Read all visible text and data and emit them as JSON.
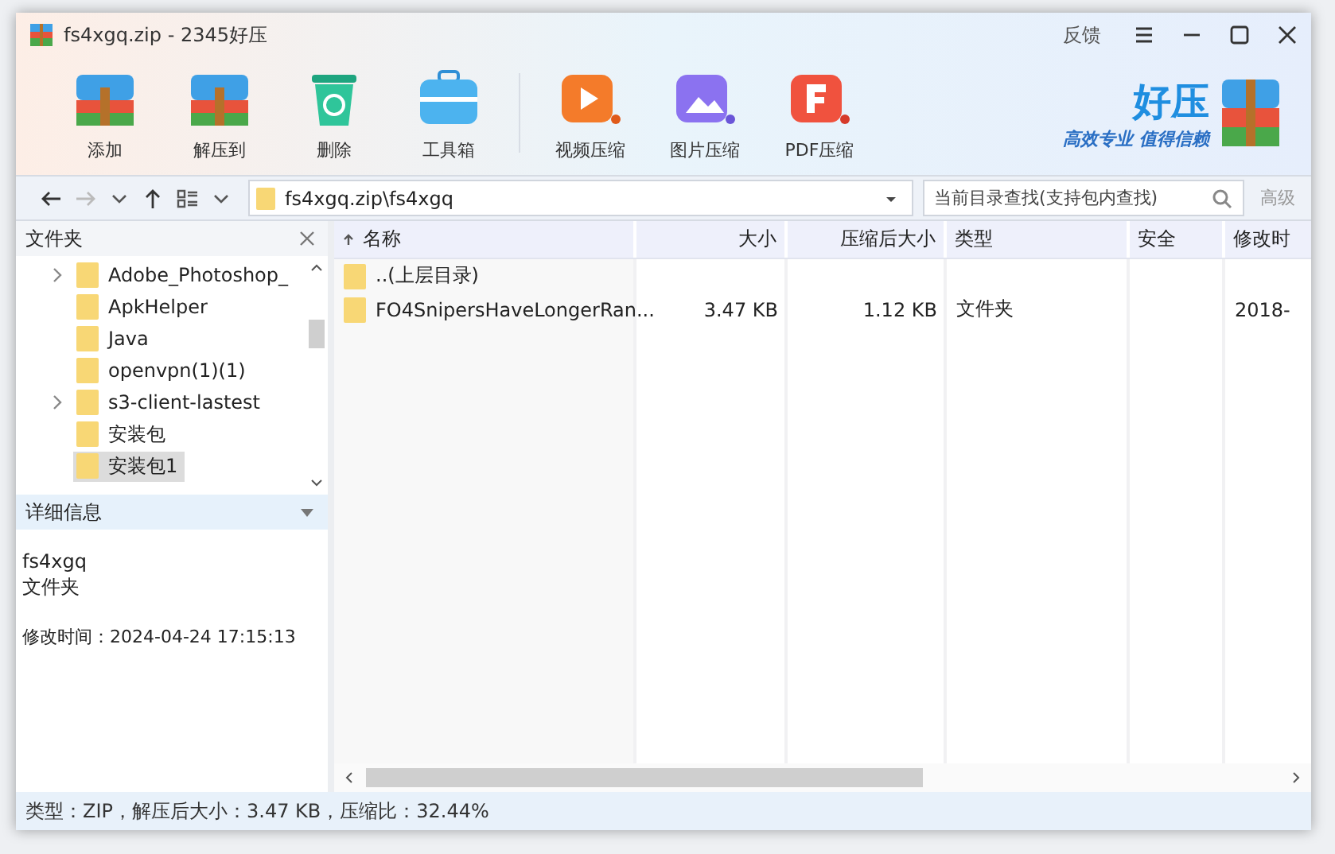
{
  "window": {
    "title": "fs4xgq.zip - 2345好压",
    "feedback": "反馈"
  },
  "toolbar": [
    {
      "label": "添加",
      "kind": "add"
    },
    {
      "label": "解压到",
      "kind": "extract"
    },
    {
      "label": "删除",
      "kind": "delete"
    },
    {
      "label": "工具箱",
      "kind": "tools"
    },
    {
      "label": "视频压缩",
      "kind": "video"
    },
    {
      "label": "图片压缩",
      "kind": "image"
    },
    {
      "label": "PDF压缩",
      "kind": "pdf"
    }
  ],
  "brand": {
    "name": "好压",
    "slogan": "高效专业 值得信赖"
  },
  "nav": {
    "back_disabled": false,
    "forward_disabled": true,
    "path": "fs4xgq.zip\\fs4xgq",
    "search": {
      "placeholder": "当前目录查找(支持包内查找)"
    },
    "filter": "高级"
  },
  "sidebar": {
    "title": "文件夹",
    "items": [
      {
        "label": "Adobe_Photoshop_",
        "expandable": true,
        "selected": false
      },
      {
        "label": "ApkHelper",
        "expandable": false,
        "selected": false
      },
      {
        "label": "Java",
        "expandable": false,
        "selected": false
      },
      {
        "label": "openvpn(1)(1)",
        "expandable": false,
        "selected": false
      },
      {
        "label": "s3-client-lastest",
        "expandable": true,
        "selected": false
      },
      {
        "label": "安装包",
        "expandable": false,
        "selected": false
      },
      {
        "label": "安装包1",
        "expandable": false,
        "selected": true
      }
    ]
  },
  "details": {
    "title": "详细信息",
    "name": "fs4xgq",
    "type": "文件夹",
    "modified": "修改时间：2024-04-24 17:15:13"
  },
  "table": {
    "columns": [
      {
        "label": "名称",
        "sorted": true
      },
      {
        "label": "大小",
        "sorted": false
      },
      {
        "label": "压缩后大小",
        "sorted": false
      },
      {
        "label": "类型",
        "sorted": false
      },
      {
        "label": "安全",
        "sorted": false
      },
      {
        "label": "修改时",
        "sorted": false
      }
    ],
    "rows": [
      {
        "cells": [
          "..(上层目录)",
          "",
          "",
          "",
          "",
          ""
        ]
      },
      {
        "cells": [
          "FO4SnipersHaveLongerRan...",
          "3.47 KB",
          "1.12 KB",
          "文件夹",
          "",
          "2018-"
        ]
      }
    ]
  },
  "status_bar": "类型：ZIP，解压后大小：3.47 KB，压缩比：32.44%"
}
